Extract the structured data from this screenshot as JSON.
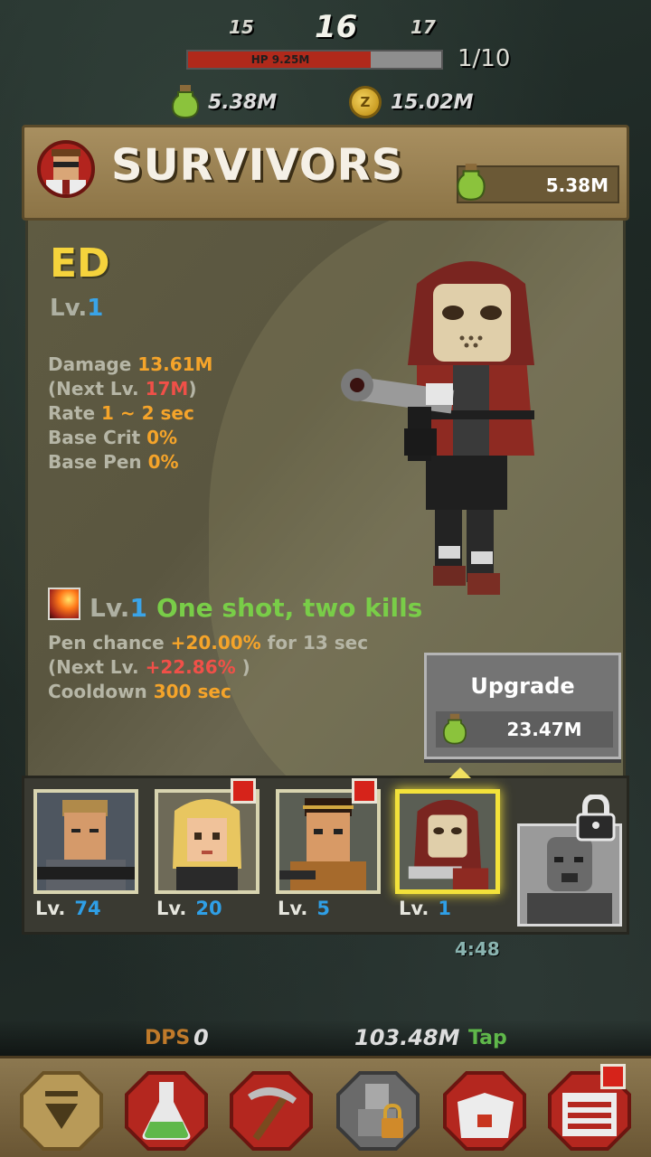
{
  "hud": {
    "stage_prev": "15",
    "stage_current": "16",
    "stage_next": "17",
    "hp_label": "HP 9.25M",
    "hp_fraction": 0.72,
    "wave": "1/10",
    "potion_amount": "5.38M",
    "coin_amount": "15.02M",
    "coin_symbol": "Z"
  },
  "panel": {
    "title": "SURVIVORS",
    "potion_amount": "5.38M"
  },
  "character": {
    "name": "ED",
    "lv_prefix": "Lv.",
    "lv_value": "1",
    "damage_label": "Damage",
    "damage_value": "13.61M",
    "next_prefix": "(Next Lv.",
    "next_value": "17M",
    "next_suffix": ")",
    "rate_label": "Rate",
    "rate_value": "1 ~ 2 sec",
    "crit_label": "Base Crit",
    "crit_value": "0%",
    "pen_label": "Base Pen",
    "pen_value": "0%"
  },
  "skill": {
    "lv_prefix": "Lv.",
    "lv_value": "1",
    "name": "One shot, two kills",
    "pen_label": "Pen chance",
    "pen_value": "+20.00%",
    "pen_suffix": "for 13 sec",
    "next_prefix": "(Next Lv.",
    "next_value": "+22.86%",
    "next_suffix": ")",
    "cooldown_label": "Cooldown",
    "cooldown_value": "300 sec"
  },
  "upgrade": {
    "label": "Upgrade",
    "cost": "23.47M"
  },
  "survivors": [
    {
      "lv_prefix": "Lv.",
      "lv_value": "74",
      "notify": false
    },
    {
      "lv_prefix": "Lv.",
      "lv_value": "20",
      "notify": true
    },
    {
      "lv_prefix": "Lv.",
      "lv_value": "5",
      "notify": true
    },
    {
      "lv_prefix": "Lv.",
      "lv_value": "1",
      "notify": false,
      "selected": true
    }
  ],
  "timer": "4:48",
  "footer": {
    "dps_label": "DPS",
    "dps_value": "0",
    "tap_value": "103.48M",
    "tap_label": "Tap"
  },
  "nav": [
    {
      "icon": "collapse-arrow-icon"
    },
    {
      "icon": "potion-flask-icon"
    },
    {
      "icon": "pickaxe-icon"
    },
    {
      "icon": "locked-character-icon"
    },
    {
      "icon": "shop-box-icon"
    },
    {
      "icon": "menu-list-icon",
      "notify": true
    }
  ],
  "colors": {
    "name": "#f5d33c",
    "stat_value": "#f5a42a",
    "stat_next": "#f05048",
    "skill_name": "#79cd48",
    "level_value": "#3aa4e8",
    "selected_border": "#f3e23a",
    "notify": "#d6231a"
  }
}
